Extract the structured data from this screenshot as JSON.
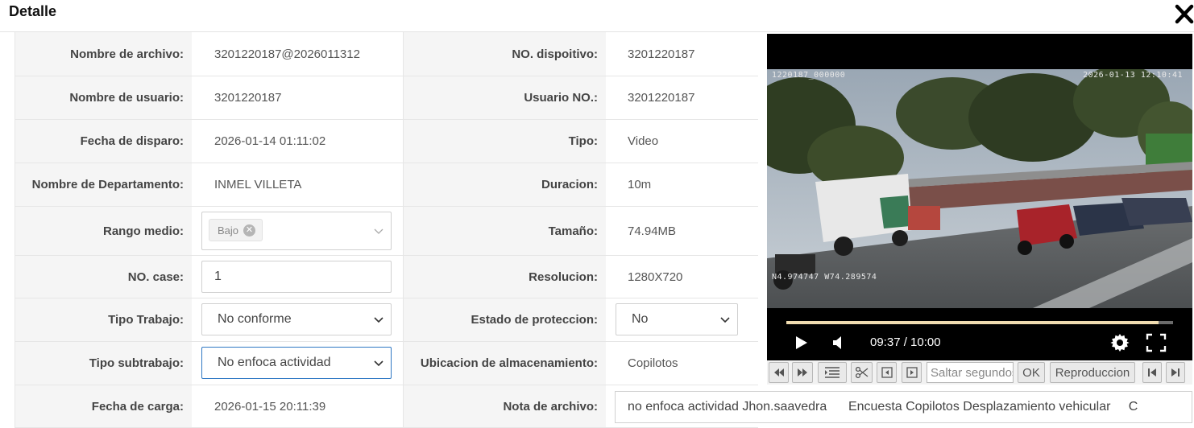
{
  "dialog": {
    "title": "Detalle",
    "close_icon": "close-icon"
  },
  "fields": {
    "nombre_archivo": {
      "label": "Nombre de archivo:",
      "value": "3201220187@2026011312"
    },
    "no_dispositivo": {
      "label": "NO. dispoitivo:",
      "value": "3201220187"
    },
    "nombre_usuario": {
      "label": "Nombre de usuario:",
      "value": "3201220187"
    },
    "usuario_no": {
      "label": "Usuario NO.:",
      "value": "3201220187"
    },
    "fecha_disparo": {
      "label": "Fecha de disparo:",
      "value": "2026-01-14 01:11:02"
    },
    "tipo": {
      "label": "Tipo:",
      "value": "Video"
    },
    "departamento": {
      "label": "Nombre de Departamento:",
      "value": "INMEL VILLETA"
    },
    "duracion": {
      "label": "Duracion:",
      "value": "10m"
    },
    "rango_medio": {
      "label": "Rango medio:",
      "tag": "Bajo"
    },
    "tamano": {
      "label": "Tamaño:",
      "value": "74.94MB"
    },
    "no_case": {
      "label": "NO. case:",
      "value": "1"
    },
    "resolucion": {
      "label": "Resolucion:",
      "value": "1280X720"
    },
    "tipo_trabajo": {
      "label": "Tipo Trabajo:",
      "value": "No conforme"
    },
    "estado_proteccion": {
      "label": "Estado de proteccion:",
      "value": "No"
    },
    "tipo_subtrabajo": {
      "label": "Tipo subtrabajo:",
      "value": "No enfoca actividad"
    },
    "ubicacion": {
      "label": "Ubicacion de almacenamiento:",
      "value": "Copilotos"
    },
    "fecha_carga": {
      "label": "Fecha de carga:",
      "value": "2026-01-15 20:11:39"
    },
    "nota_archivo": {
      "label": "Nota de archivo:",
      "value": "no enfoca actividad Jhon.saavedra      Encuesta Copilotos Desplazamiento vehicular     C"
    }
  },
  "player": {
    "osd_id": "1220187_000000",
    "osd_datetime": "2026-01-13  12:10:41",
    "osd_gps": "N4.974747  W74.289574",
    "time": "09:37 / 10:00",
    "progress": 0.962
  },
  "toolbar": {
    "seek_placeholder": "Saltar segundos",
    "ok_label": "OK",
    "playback_label": "Reproduccion"
  },
  "colors": {
    "progress_fill": "#f0dcb0",
    "focus_border": "#2f78c4",
    "label_bg": "#f5f5f5"
  }
}
